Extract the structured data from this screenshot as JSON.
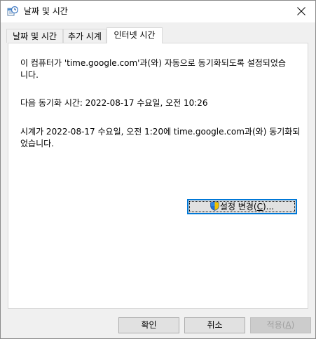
{
  "window": {
    "title": "날짜 및 시간"
  },
  "tabs": [
    {
      "label": "날짜 및 시간",
      "active": false
    },
    {
      "label": "추가 시계",
      "active": false
    },
    {
      "label": "인터넷 시간",
      "active": true
    }
  ],
  "panel": {
    "sync_config_text": "이 컴퓨터가 'time.google.com'과(와) 자동으로 동기화되도록 설정되었습\n니다.",
    "next_sync_text": "다음 동기화 시간: 2022-08-17 수요일, 오전 10:26",
    "last_sync_text": "시계가 2022-08-17 수요일, 오전 1:20에 time.google.com과(와) 동기화되\n었습니다.",
    "change_settings": {
      "label_before": "설정 변경(",
      "mnemonic": "C",
      "label_after": ")..."
    }
  },
  "footer": {
    "ok_label": "확인",
    "cancel_label": "취소",
    "apply_before": "적용(",
    "apply_mnemonic": "A",
    "apply_after": ")",
    "apply_disabled": true
  },
  "colors": {
    "accent": "#0078d7",
    "panel_bg": "#ffffff",
    "window_bg": "#f0f0f0",
    "button_bg": "#e1e1e1",
    "disabled_text": "#a0a0a0"
  }
}
